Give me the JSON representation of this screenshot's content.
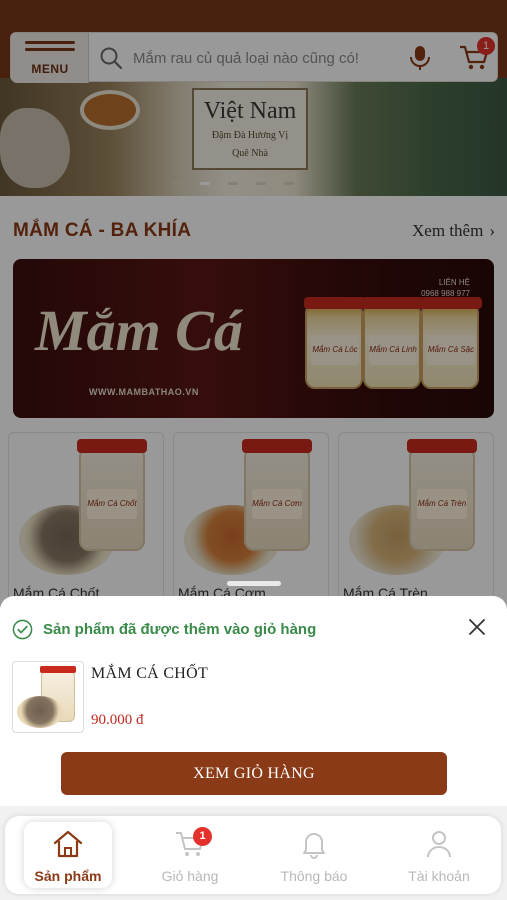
{
  "header": {
    "menu_label": "MENU",
    "search_placeholder": "Mắm rau củ quả loại nào cũng có!",
    "cart_count": "1"
  },
  "hero": {
    "sign_title": "Việt Nam",
    "sign_line1": "Đậm Đà Hương Vị",
    "sign_line2": "Quê Nhà",
    "slides_total": 5,
    "active_slide": 2
  },
  "section": {
    "title": "MẮM CÁ - BA KHÍA",
    "see_more": "Xem thêm"
  },
  "promo": {
    "script_text": "Mắm Cá",
    "website": "WWW.MAMBATHAO.VN",
    "contact_label": "LIÊN HỆ",
    "phone": "0968 988 977",
    "jar_labels": [
      "Mắm Cá Lóc",
      "Mắm Cá Linh",
      "Mắm Cá Sặc"
    ]
  },
  "products": [
    {
      "name": "Mắm Cá Chốt",
      "jar_label": "Mắm Cá Chốt"
    },
    {
      "name": "Mắm Cá Cơm",
      "jar_label": "Mắm Cá Cơm"
    },
    {
      "name": "Mắm Cá Trèn",
      "jar_label": "Mắm Cá Trèn"
    }
  ],
  "sheet": {
    "notice": "Sản phẩm đã được thêm vào giỏ hàng",
    "product_name": "MẮM CÁ CHỐT",
    "product_price": "90.000 đ",
    "view_cart_label": "XEM GIỎ HÀNG"
  },
  "nav": {
    "items": [
      {
        "label": "Sản phẩm",
        "icon": "home-icon",
        "active": true
      },
      {
        "label": "Giỏ hàng",
        "icon": "cart-icon",
        "active": false
      },
      {
        "label": "Thông báo",
        "icon": "bell-icon",
        "active": false
      },
      {
        "label": "Tài khoản",
        "icon": "user-icon",
        "active": false
      }
    ],
    "cart_badge": "1"
  },
  "colors": {
    "brand": "#8a3a16",
    "success": "#3a8a4a",
    "price": "#c2281f",
    "badge": "#e4312b"
  }
}
